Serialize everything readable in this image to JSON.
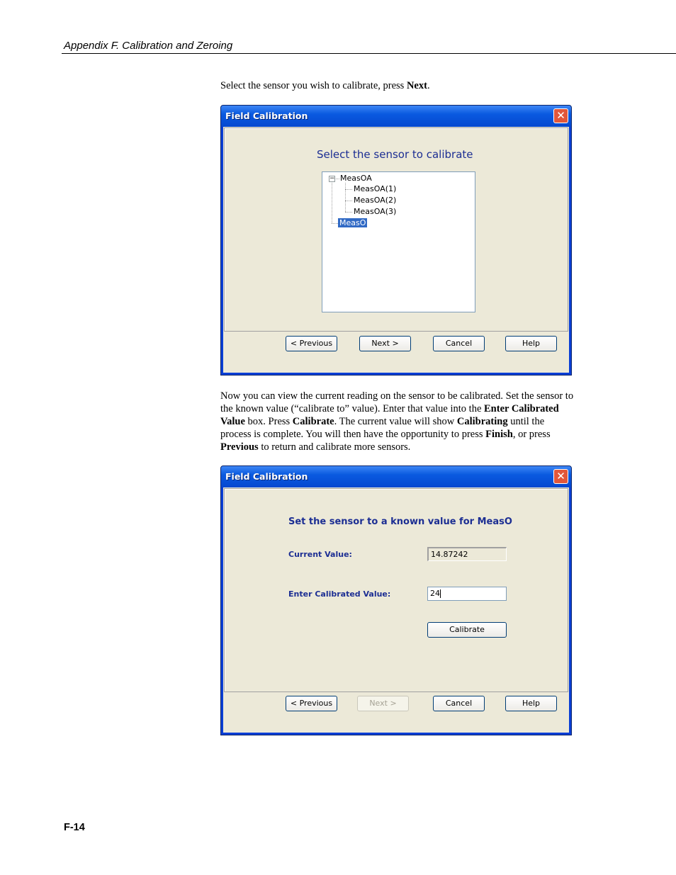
{
  "header": {
    "title": "Appendix F.  Calibration and Zeroing"
  },
  "intro": {
    "text_before": "Select the sensor you wish to calibrate, press ",
    "bold": "Next",
    "text_after": "."
  },
  "dialog1": {
    "title": "Field Calibration",
    "close_glyph": "✕",
    "heading": "Select the sensor to calibrate",
    "tree": {
      "expander_glyph": "−",
      "root": "MeasOA",
      "children": [
        "MeasOA(1)",
        "MeasOA(2)",
        "MeasOA(3)"
      ],
      "selected": "MeasO"
    },
    "buttons": {
      "previous": "< Previous",
      "next": "Next >",
      "cancel": "Cancel",
      "help": "Help"
    }
  },
  "paragraph2": {
    "p1": "Now you can view the current reading on the sensor to be calibrated.  Set the sensor to the known value (“calibrate to” value).  Enter that value into the ",
    "b1": "Enter Calibrated Value",
    "p2": " box.  Press ",
    "b2": "Calibrate",
    "p3": ".  The current value will show ",
    "b3": "Calibrating",
    "p4": " until the process is complete.  You will then have the opportunity to press ",
    "b4": "Finish",
    "p5": ", or press ",
    "b5": "Previous",
    "p6": " to return and calibrate more sensors."
  },
  "dialog2": {
    "title": "Field Calibration",
    "close_glyph": "✕",
    "heading": "Set the sensor to a known value for MeasO",
    "current_value_label": "Current Value:",
    "current_value": "14.87242",
    "calibrated_value_label": "Enter Calibrated Value:",
    "calibrated_value": "24",
    "calibrate_button": "Calibrate",
    "buttons": {
      "previous": "< Previous",
      "next": "Next >",
      "cancel": "Cancel",
      "help": "Help"
    }
  },
  "footer": {
    "page_number": "F-14"
  }
}
